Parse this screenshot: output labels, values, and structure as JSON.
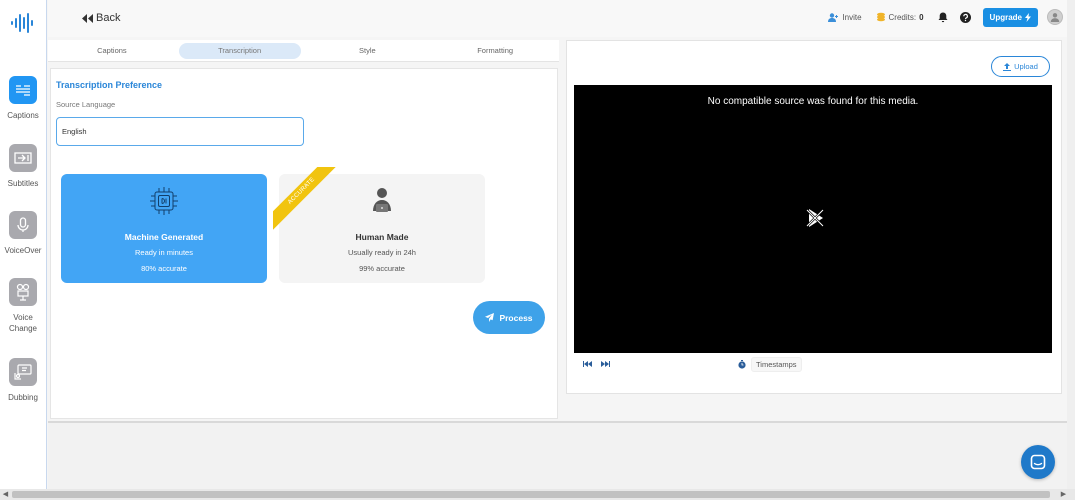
{
  "header": {
    "back_label": "Back",
    "invite_label": "Invite",
    "credits_label": "Credits:",
    "credits_value": "0",
    "upgrade_label": "Upgrade"
  },
  "sidebar": {
    "items": [
      {
        "label": "Captions",
        "icon": "captions-icon",
        "active": true
      },
      {
        "label": "Subtitles",
        "icon": "subtitles-icon",
        "active": false
      },
      {
        "label": "VoiceOver",
        "icon": "microphone-icon",
        "active": false
      },
      {
        "label": "Voice Change",
        "icon": "voice-change-icon",
        "active": false
      },
      {
        "label": "Dubbing",
        "icon": "dubbing-icon",
        "active": false
      }
    ]
  },
  "tabs": [
    {
      "label": "Captions",
      "active": false
    },
    {
      "label": "Transcription",
      "active": true
    },
    {
      "label": "Style",
      "active": false
    },
    {
      "label": "Formatting",
      "active": false
    }
  ],
  "transcription": {
    "title": "Transcription Preference",
    "source_language_label": "Source Language",
    "source_language_value": "English",
    "options": {
      "machine": {
        "title": "Machine Generated",
        "subtitle": "Ready in minutes",
        "accuracy": "80% accurate",
        "selected": true
      },
      "human": {
        "title": "Human Made",
        "subtitle": "Usually ready in 24h",
        "accuracy": "99% accurate",
        "badge": "ACCURATE",
        "selected": false
      }
    },
    "process_label": "Process"
  },
  "player": {
    "upload_label": "Upload",
    "error_message": "No compatible source was found for this media.",
    "timestamps_label": "Timestamps"
  },
  "colors": {
    "accent": "#2196f3",
    "selected_card": "#42a5f5",
    "ribbon": "#f1c40f",
    "chat": "#1f79c9"
  }
}
